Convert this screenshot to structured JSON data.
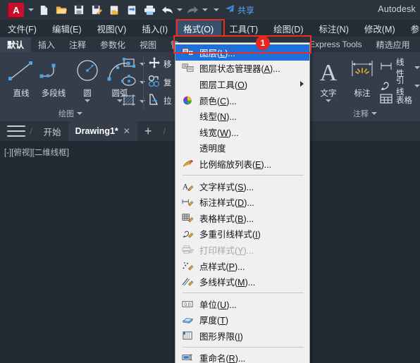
{
  "titlebar": {
    "logo_label": "A",
    "share_label": "共享",
    "product": "Autodesk",
    "quick_access": [
      {
        "name": "new-file-icon",
        "label": "新建"
      },
      {
        "name": "open-file-icon",
        "label": "打开"
      },
      {
        "name": "save-icon",
        "label": "保存"
      },
      {
        "name": "save-as-icon",
        "label": "另存为"
      },
      {
        "name": "export-icon",
        "label": "输出"
      },
      {
        "name": "cloud-save-icon",
        "label": "保存到云"
      },
      {
        "name": "print-icon",
        "label": "打印"
      },
      {
        "name": "undo-icon",
        "label": "放弃"
      },
      {
        "name": "redo-icon",
        "label": "重做"
      },
      {
        "name": "customize-icon",
        "label": "自定义"
      },
      {
        "name": "share-icon",
        "label": "共享"
      }
    ]
  },
  "menubar": {
    "items": [
      {
        "label": "文件(F)",
        "active": false
      },
      {
        "label": "编辑(E)",
        "active": false
      },
      {
        "label": "视图(V)",
        "active": false
      },
      {
        "label": "插入(I)",
        "active": false
      },
      {
        "label": "格式(O)",
        "active": true
      },
      {
        "label": "工具(T)",
        "active": false
      },
      {
        "label": "绘图(D)",
        "active": false
      },
      {
        "label": "标注(N)",
        "active": false
      },
      {
        "label": "修改(M)",
        "active": false
      },
      {
        "label": "参",
        "active": false
      }
    ]
  },
  "ribbon_tabs": {
    "items": [
      {
        "label": "默认",
        "selected": true
      },
      {
        "label": "插入",
        "selected": false
      },
      {
        "label": "注释",
        "selected": false
      },
      {
        "label": "参数化",
        "selected": false
      },
      {
        "label": "视图",
        "selected": false
      },
      {
        "label": "管",
        "selected": false
      },
      {
        "label": "Express Tools",
        "selected": false
      },
      {
        "label": "精选应用",
        "selected": false
      }
    ]
  },
  "ribbon": {
    "draw_panel": {
      "title": "绘图",
      "big_buttons": [
        {
          "label": "直线",
          "icon": "line-icon",
          "has_dropdown": false
        },
        {
          "label": "多段线",
          "icon": "polyline-icon",
          "has_dropdown": false
        },
        {
          "label": "圆",
          "icon": "circle-icon",
          "has_dropdown": true
        },
        {
          "label": "圆弧",
          "icon": "arc-icon",
          "has_dropdown": true
        }
      ],
      "small_buttons": [
        {
          "label": "",
          "icon": "rectangle-icon",
          "has_dropdown": true
        },
        {
          "label": "",
          "icon": "ellipse-icon",
          "has_dropdown": true
        },
        {
          "label": "",
          "icon": "hatch-icon",
          "has_dropdown": true
        }
      ]
    },
    "modify_panel": {
      "items": [
        {
          "label": "移",
          "icon": "move-icon",
          "has_dropdown": false
        },
        {
          "label": "复",
          "icon": "copy-icon",
          "has_dropdown": false
        },
        {
          "label": "拉",
          "icon": "stretch-icon",
          "has_dropdown": false
        }
      ]
    },
    "annotation_panel": {
      "title": "注释",
      "big_buttons": [
        {
          "label": "文字",
          "icon": "text-icon",
          "has_dropdown": true
        },
        {
          "label": "标注",
          "icon": "dimension-icon",
          "has_dropdown": false
        }
      ],
      "small_buttons": [
        {
          "label": "线性",
          "icon": "linear-dim-icon",
          "has_dropdown": true
        },
        {
          "label": "引线",
          "icon": "leader-icon",
          "has_dropdown": true
        },
        {
          "label": "表格",
          "icon": "table-icon",
          "has_dropdown": false
        }
      ]
    }
  },
  "file_tabs": {
    "start_label": "开始",
    "tabs": [
      {
        "label": "Drawing1*",
        "active": true,
        "close_glyph": "✕"
      }
    ],
    "new_tab_glyph": "+"
  },
  "canvas": {
    "view_label": "[-][俯视][二维线框]"
  },
  "format_menu": {
    "title": "格式(O)",
    "highlight_color": "#ee2b20",
    "selected_bg": "#1e6fd9",
    "badge": "1",
    "items": [
      {
        "label": "图层(L)...",
        "icon": "layers-icon",
        "highlighted": true,
        "disabled": false,
        "submenu": false,
        "accel": "L"
      },
      {
        "label": "图层状态管理器(A)...",
        "icon": "layer-state-icon",
        "highlighted": false,
        "disabled": false,
        "submenu": false,
        "accel": "A"
      },
      {
        "label": "图层工具(O)",
        "icon": "none",
        "highlighted": false,
        "disabled": false,
        "submenu": true,
        "accel": "O"
      },
      {
        "label": "颜色(C)...",
        "icon": "color-wheel-icon",
        "highlighted": false,
        "disabled": false,
        "submenu": false,
        "accel": "C"
      },
      {
        "label": "线型(N)...",
        "icon": "none",
        "highlighted": false,
        "disabled": false,
        "submenu": false,
        "accel": "N"
      },
      {
        "label": "线宽(W)...",
        "icon": "none",
        "highlighted": false,
        "disabled": false,
        "submenu": false,
        "accel": "W"
      },
      {
        "label": "透明度",
        "icon": "none",
        "highlighted": false,
        "disabled": false,
        "submenu": false,
        "accel": ""
      },
      {
        "label": "比例缩放列表(E)...",
        "icon": "scale-list-icon",
        "highlighted": false,
        "disabled": false,
        "submenu": false,
        "accel": "E"
      },
      {
        "separator": true
      },
      {
        "label": "文字样式(S)...",
        "icon": "text-style-icon",
        "highlighted": false,
        "disabled": false,
        "submenu": false,
        "accel": "S"
      },
      {
        "label": "标注样式(D)...",
        "icon": "dim-style-icon",
        "highlighted": false,
        "disabled": false,
        "submenu": false,
        "accel": "D"
      },
      {
        "label": "表格样式(B)...",
        "icon": "table-style-icon",
        "highlighted": false,
        "disabled": false,
        "submenu": false,
        "accel": "B"
      },
      {
        "label": "多重引线样式(I)",
        "icon": "mleader-style-icon",
        "highlighted": false,
        "disabled": false,
        "submenu": false,
        "accel": "I"
      },
      {
        "label": "打印样式(Y)...",
        "icon": "plot-style-icon",
        "highlighted": false,
        "disabled": true,
        "submenu": false,
        "accel": "Y"
      },
      {
        "label": "点样式(P)...",
        "icon": "point-style-icon",
        "highlighted": false,
        "disabled": false,
        "submenu": false,
        "accel": "P"
      },
      {
        "label": "多线样式(M)...",
        "icon": "mline-style-icon",
        "highlighted": false,
        "disabled": false,
        "submenu": false,
        "accel": "M"
      },
      {
        "separator": true
      },
      {
        "label": "单位(U)...",
        "icon": "units-icon",
        "highlighted": false,
        "disabled": false,
        "submenu": false,
        "accel": "U"
      },
      {
        "label": "厚度(T)",
        "icon": "thickness-icon",
        "highlighted": false,
        "disabled": false,
        "submenu": false,
        "accel": "T"
      },
      {
        "label": "图形界限(I)",
        "icon": "drawing-limits-icon",
        "highlighted": false,
        "disabled": false,
        "submenu": false,
        "accel": "I"
      },
      {
        "separator": true
      },
      {
        "label": "重命名(R)...",
        "icon": "rename-icon",
        "highlighted": false,
        "disabled": false,
        "submenu": false,
        "accel": "R"
      }
    ]
  }
}
